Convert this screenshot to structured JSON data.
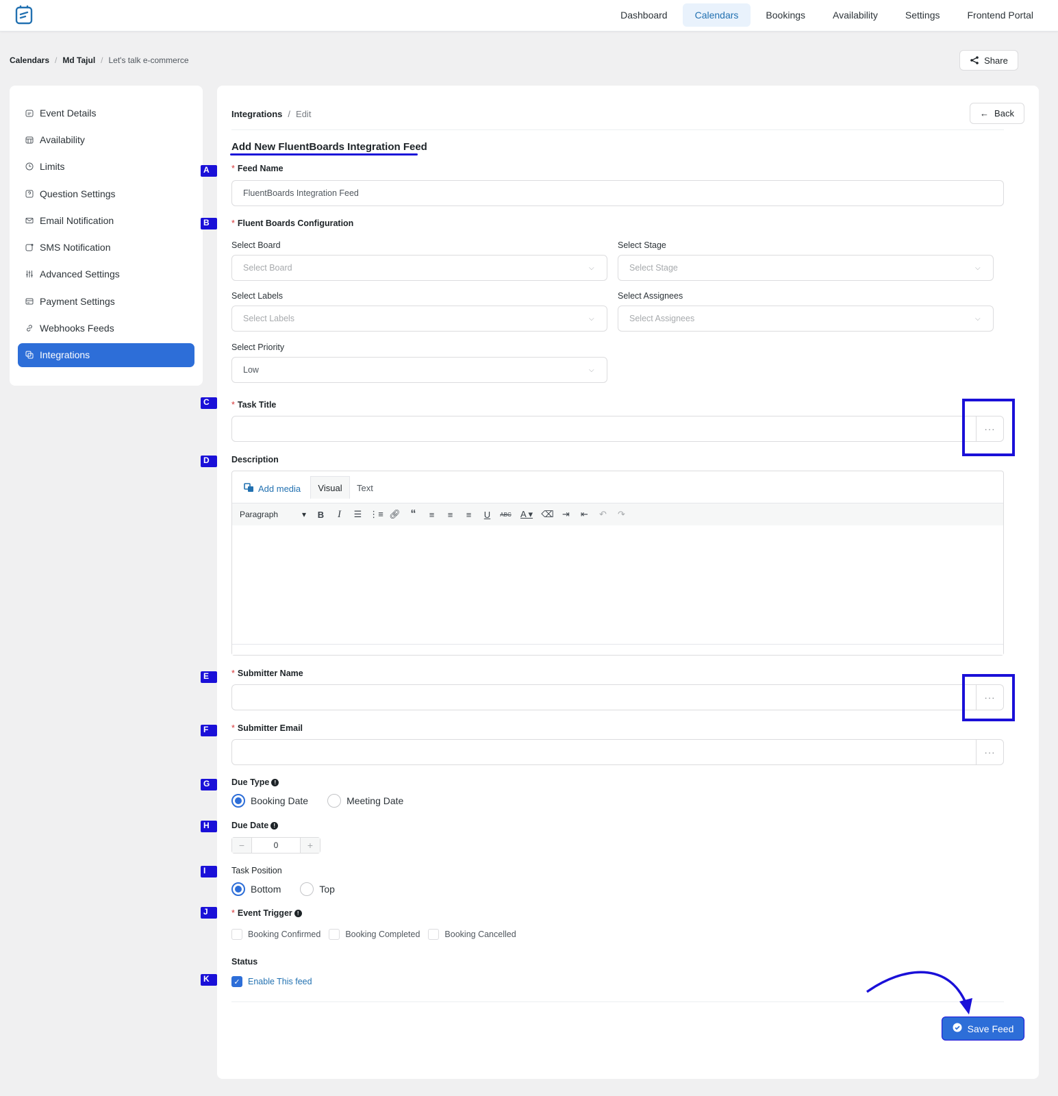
{
  "topnav": {
    "items": [
      "Dashboard",
      "Calendars",
      "Bookings",
      "Availability",
      "Settings",
      "Frontend Portal"
    ],
    "active": "Calendars"
  },
  "breadcrumb": {
    "root": "Calendars",
    "user": "Md Tajul",
    "event": "Let's talk e-commerce"
  },
  "share_label": "Share",
  "sidebar": {
    "items": [
      {
        "label": "Event Details",
        "icon": "calendar-icon"
      },
      {
        "label": "Availability",
        "icon": "calendar-grid-icon"
      },
      {
        "label": "Limits",
        "icon": "clock-icon"
      },
      {
        "label": "Question Settings",
        "icon": "question-icon"
      },
      {
        "label": "Email Notification",
        "icon": "mail-icon"
      },
      {
        "label": "SMS Notification",
        "icon": "sms-icon"
      },
      {
        "label": "Advanced Settings",
        "icon": "sliders-icon"
      },
      {
        "label": "Payment Settings",
        "icon": "payment-icon"
      },
      {
        "label": "Webhooks Feeds",
        "icon": "link-icon"
      },
      {
        "label": "Integrations",
        "icon": "integrations-icon"
      }
    ],
    "active": "Integrations"
  },
  "panel": {
    "crumb_root": "Integrations",
    "crumb_current": "Edit",
    "back_label": "Back",
    "title": "Add New FluentBoards Integration Feed"
  },
  "form": {
    "feed_name_label": "Feed Name",
    "feed_name_value": "FluentBoards Integration Feed",
    "config_label": "Fluent Boards Configuration",
    "board_label": "Select Board",
    "board_placeholder": "Select Board",
    "stage_label": "Select Stage",
    "stage_placeholder": "Select Stage",
    "labels_label": "Select Labels",
    "labels_placeholder": "Select Labels",
    "assignees_label": "Select Assignees",
    "assignees_placeholder": "Select Assignees",
    "priority_label": "Select Priority",
    "priority_value": "Low",
    "task_title_label": "Task Title",
    "description_label": "Description",
    "submitter_name_label": "Submitter Name",
    "submitter_email_label": "Submitter Email",
    "due_type_label": "Due Type",
    "due_type_options": [
      "Booking Date",
      "Meeting Date"
    ],
    "due_type_selected": "Booking Date",
    "due_date_label": "Due Date",
    "due_date_value": "0",
    "task_position_label": "Task Position",
    "task_position_options": [
      "Bottom",
      "Top"
    ],
    "task_position_selected": "Bottom",
    "event_trigger_label": "Event Trigger",
    "event_trigger_options": [
      "Booking Confirmed",
      "Booking Completed",
      "Booking Cancelled"
    ],
    "status_label": "Status",
    "status_checkbox_label": "Enable This feed",
    "status_enabled": true,
    "save_label": "Save Feed"
  },
  "editor": {
    "add_media": "Add media",
    "tab_visual": "Visual",
    "tab_text": "Text",
    "format_select": "Paragraph",
    "toolbar_icons": [
      "bold-icon",
      "italic-icon",
      "bullet-list-icon",
      "numbered-list-icon",
      "link-icon",
      "blockquote-icon",
      "align-left-icon",
      "align-center-icon",
      "align-right-icon",
      "underline-icon",
      "strikethrough-icon",
      "text-color-icon",
      "clear-format-icon",
      "indent-icon",
      "outdent-icon",
      "undo-icon",
      "redo-icon"
    ]
  },
  "annotations": {
    "markers": [
      "A",
      "B",
      "C",
      "D",
      "E",
      "F",
      "G",
      "H",
      "I",
      "J",
      "K"
    ],
    "accent": "#1a10d8"
  },
  "colors": {
    "primary": "#2d6ed8",
    "link": "#2271b1",
    "required": "#d63638",
    "background": "#f0f0f1"
  }
}
